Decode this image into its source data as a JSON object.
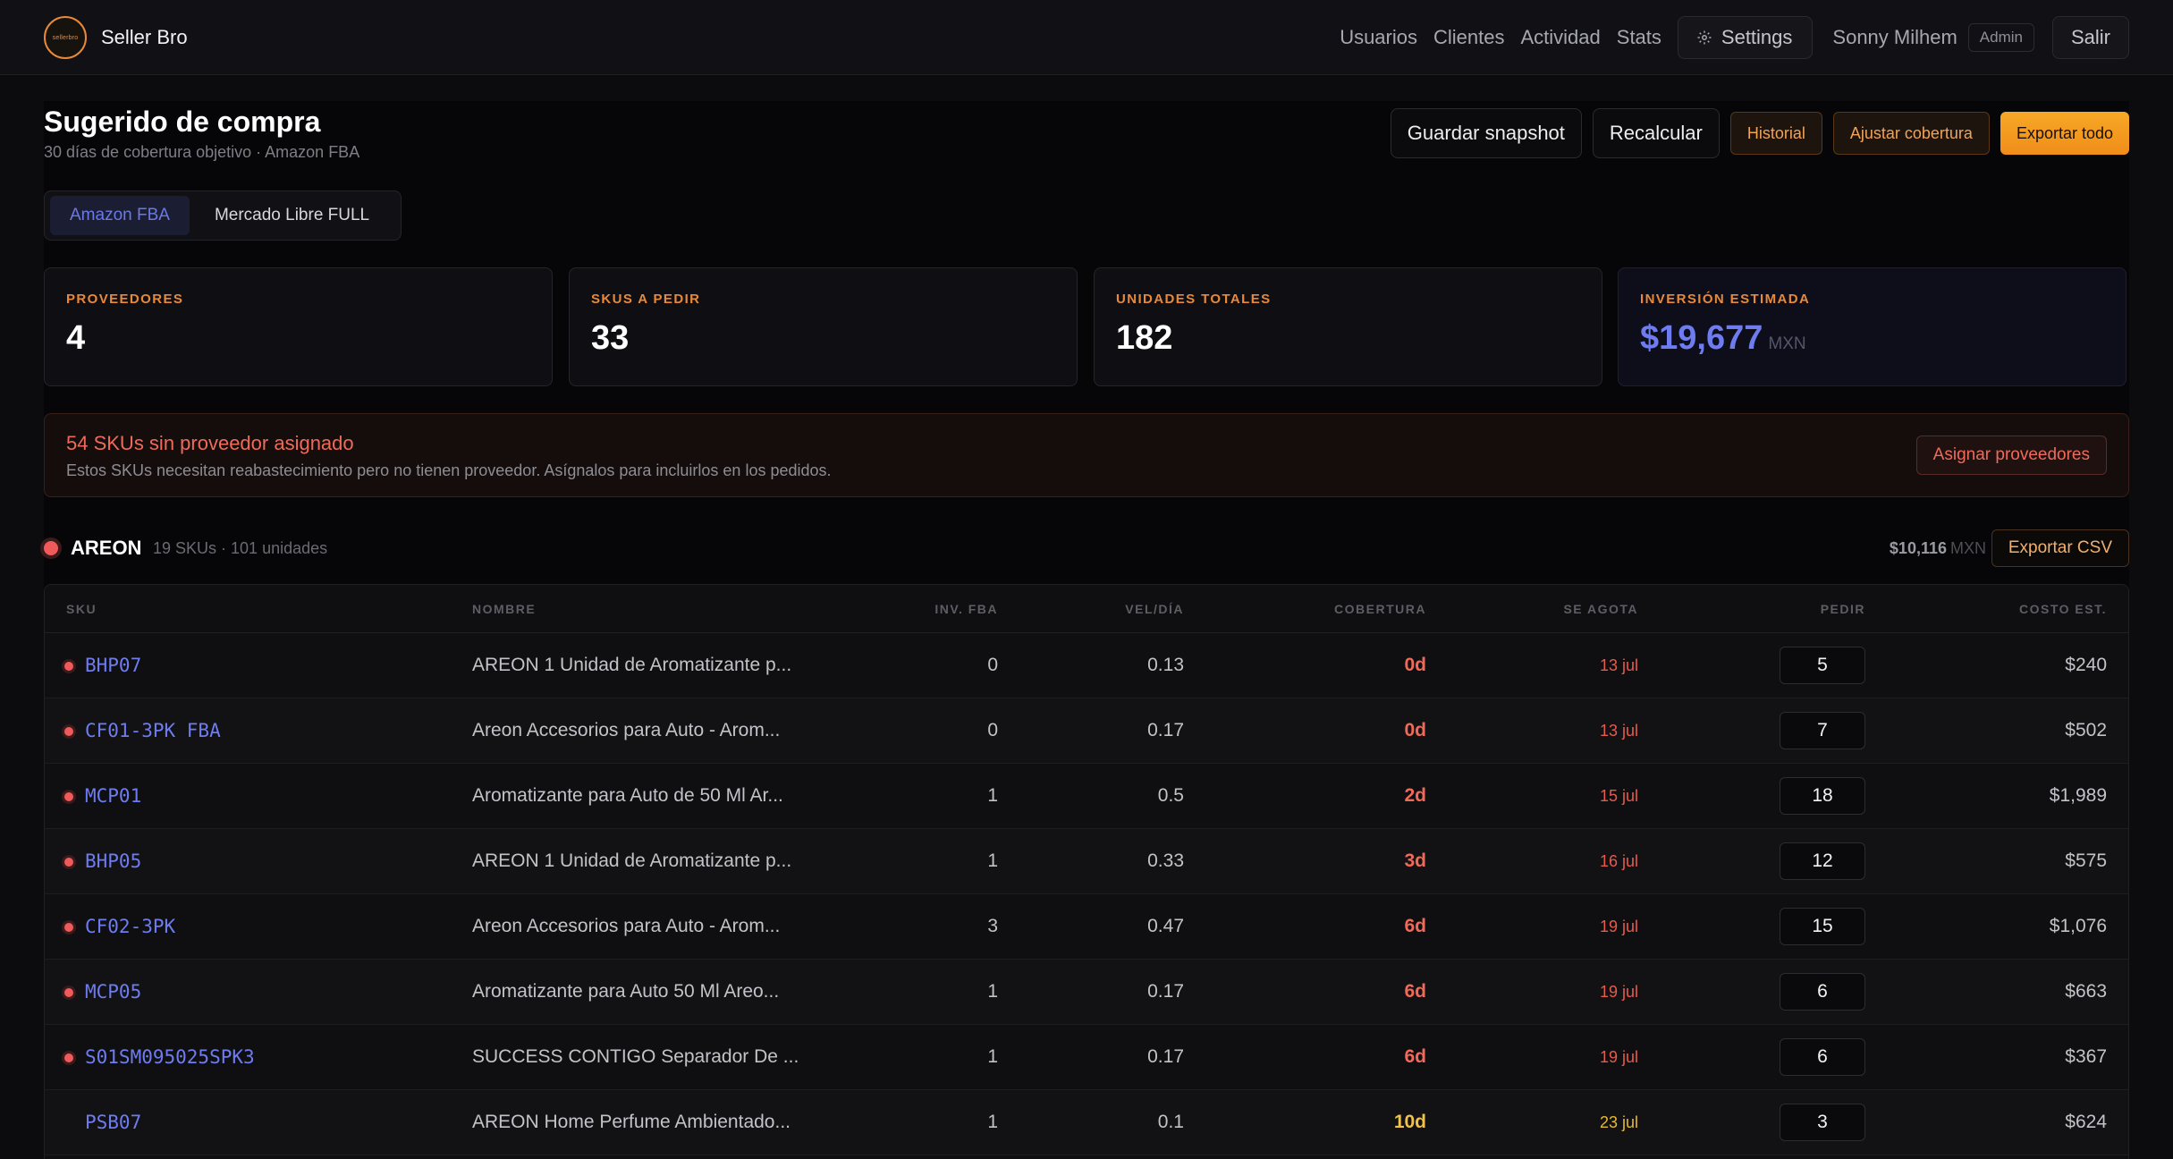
{
  "header": {
    "brand_name": "Seller Bro",
    "logo_text": "sellerbro",
    "nav": [
      "Usuarios",
      "Clientes",
      "Actividad",
      "Stats"
    ],
    "settings_label": "Settings",
    "user_name": "Sonny Milhem",
    "role_badge": "Admin",
    "logout_label": "Salir"
  },
  "page": {
    "title": "Sugerido de compra",
    "subtitle": "30 días de cobertura objetivo · Amazon FBA"
  },
  "actions": {
    "save_snapshot": "Guardar snapshot",
    "recalc": "Recalcular",
    "history": "Historial",
    "adjust": "Ajustar cobertura",
    "export_all": "Exportar todo"
  },
  "tabs": [
    {
      "label": "Amazon FBA",
      "active": true
    },
    {
      "label": "Mercado Libre FULL",
      "active": false
    }
  ],
  "stats": [
    {
      "label": "PROVEEDORES",
      "value": "4",
      "unit": ""
    },
    {
      "label": "SKUS A PEDIR",
      "value": "33",
      "unit": ""
    },
    {
      "label": "UNIDADES TOTALES",
      "value": "182",
      "unit": ""
    },
    {
      "label": "INVERSIÓN ESTIMADA",
      "value": "$19,677",
      "unit": "MXN"
    }
  ],
  "alert": {
    "title": "54 SKUs sin proveedor asignado",
    "text": "Estos SKUs necesitan reabastecimiento pero no tienen proveedor. Asígnalos para incluirlos en los pedidos.",
    "button": "Asignar proveedores"
  },
  "supplier": {
    "name": "AREON",
    "meta": "19 SKUs · 101 unidades",
    "total": "$10,116",
    "currency": "MXN",
    "export_csv": "Exportar CSV"
  },
  "table": {
    "columns": [
      "SKU",
      "NOMBRE",
      "INV. FBA",
      "VEL/DÍA",
      "COBERTURA",
      "SE AGOTA",
      "PEDIR",
      "COSTO EST."
    ],
    "rows": [
      {
        "sku": "BHP07",
        "name": "AREON 1 Unidad de Aromatizante p...",
        "inv": "0",
        "vel": "0.13",
        "cov": "0d",
        "date": "13 jul",
        "qty": "5",
        "cost": "$240",
        "urgent": true
      },
      {
        "sku": "CF01-3PK FBA",
        "name": "Areon Accesorios para Auto - Arom...",
        "inv": "0",
        "vel": "0.17",
        "cov": "0d",
        "date": "13 jul",
        "qty": "7",
        "cost": "$502",
        "urgent": true
      },
      {
        "sku": "MCP01",
        "name": "Aromatizante para Auto de 50 Ml Ar...",
        "inv": "1",
        "vel": "0.5",
        "cov": "2d",
        "date": "15 jul",
        "qty": "18",
        "cost": "$1,989",
        "urgent": true
      },
      {
        "sku": "BHP05",
        "name": "AREON 1 Unidad de Aromatizante p...",
        "inv": "1",
        "vel": "0.33",
        "cov": "3d",
        "date": "16 jul",
        "qty": "12",
        "cost": "$575",
        "urgent": true
      },
      {
        "sku": "CF02-3PK",
        "name": "Areon Accesorios para Auto - Arom...",
        "inv": "3",
        "vel": "0.47",
        "cov": "6d",
        "date": "19 jul",
        "qty": "15",
        "cost": "$1,076",
        "urgent": true
      },
      {
        "sku": "MCP05",
        "name": "Aromatizante para Auto 50 Ml Areo...",
        "inv": "1",
        "vel": "0.17",
        "cov": "6d",
        "date": "19 jul",
        "qty": "6",
        "cost": "$663",
        "urgent": true
      },
      {
        "sku": "S01SM095025SPK3",
        "name": "SUCCESS CONTIGO Separador De ...",
        "inv": "1",
        "vel": "0.17",
        "cov": "6d",
        "date": "19 jul",
        "qty": "6",
        "cost": "$367",
        "urgent": true
      },
      {
        "sku": "PSB07",
        "name": "AREON Home Perfume Ambientado...",
        "inv": "1",
        "vel": "0.1",
        "cov": "10d",
        "date": "23 jul",
        "qty": "3",
        "cost": "$624",
        "urgent": false
      }
    ]
  },
  "colors": {
    "accent_orange": "#f08d1a",
    "accent_indigo": "#6e7cf0",
    "danger": "#f06a5a",
    "warning": "#f0c24a"
  }
}
